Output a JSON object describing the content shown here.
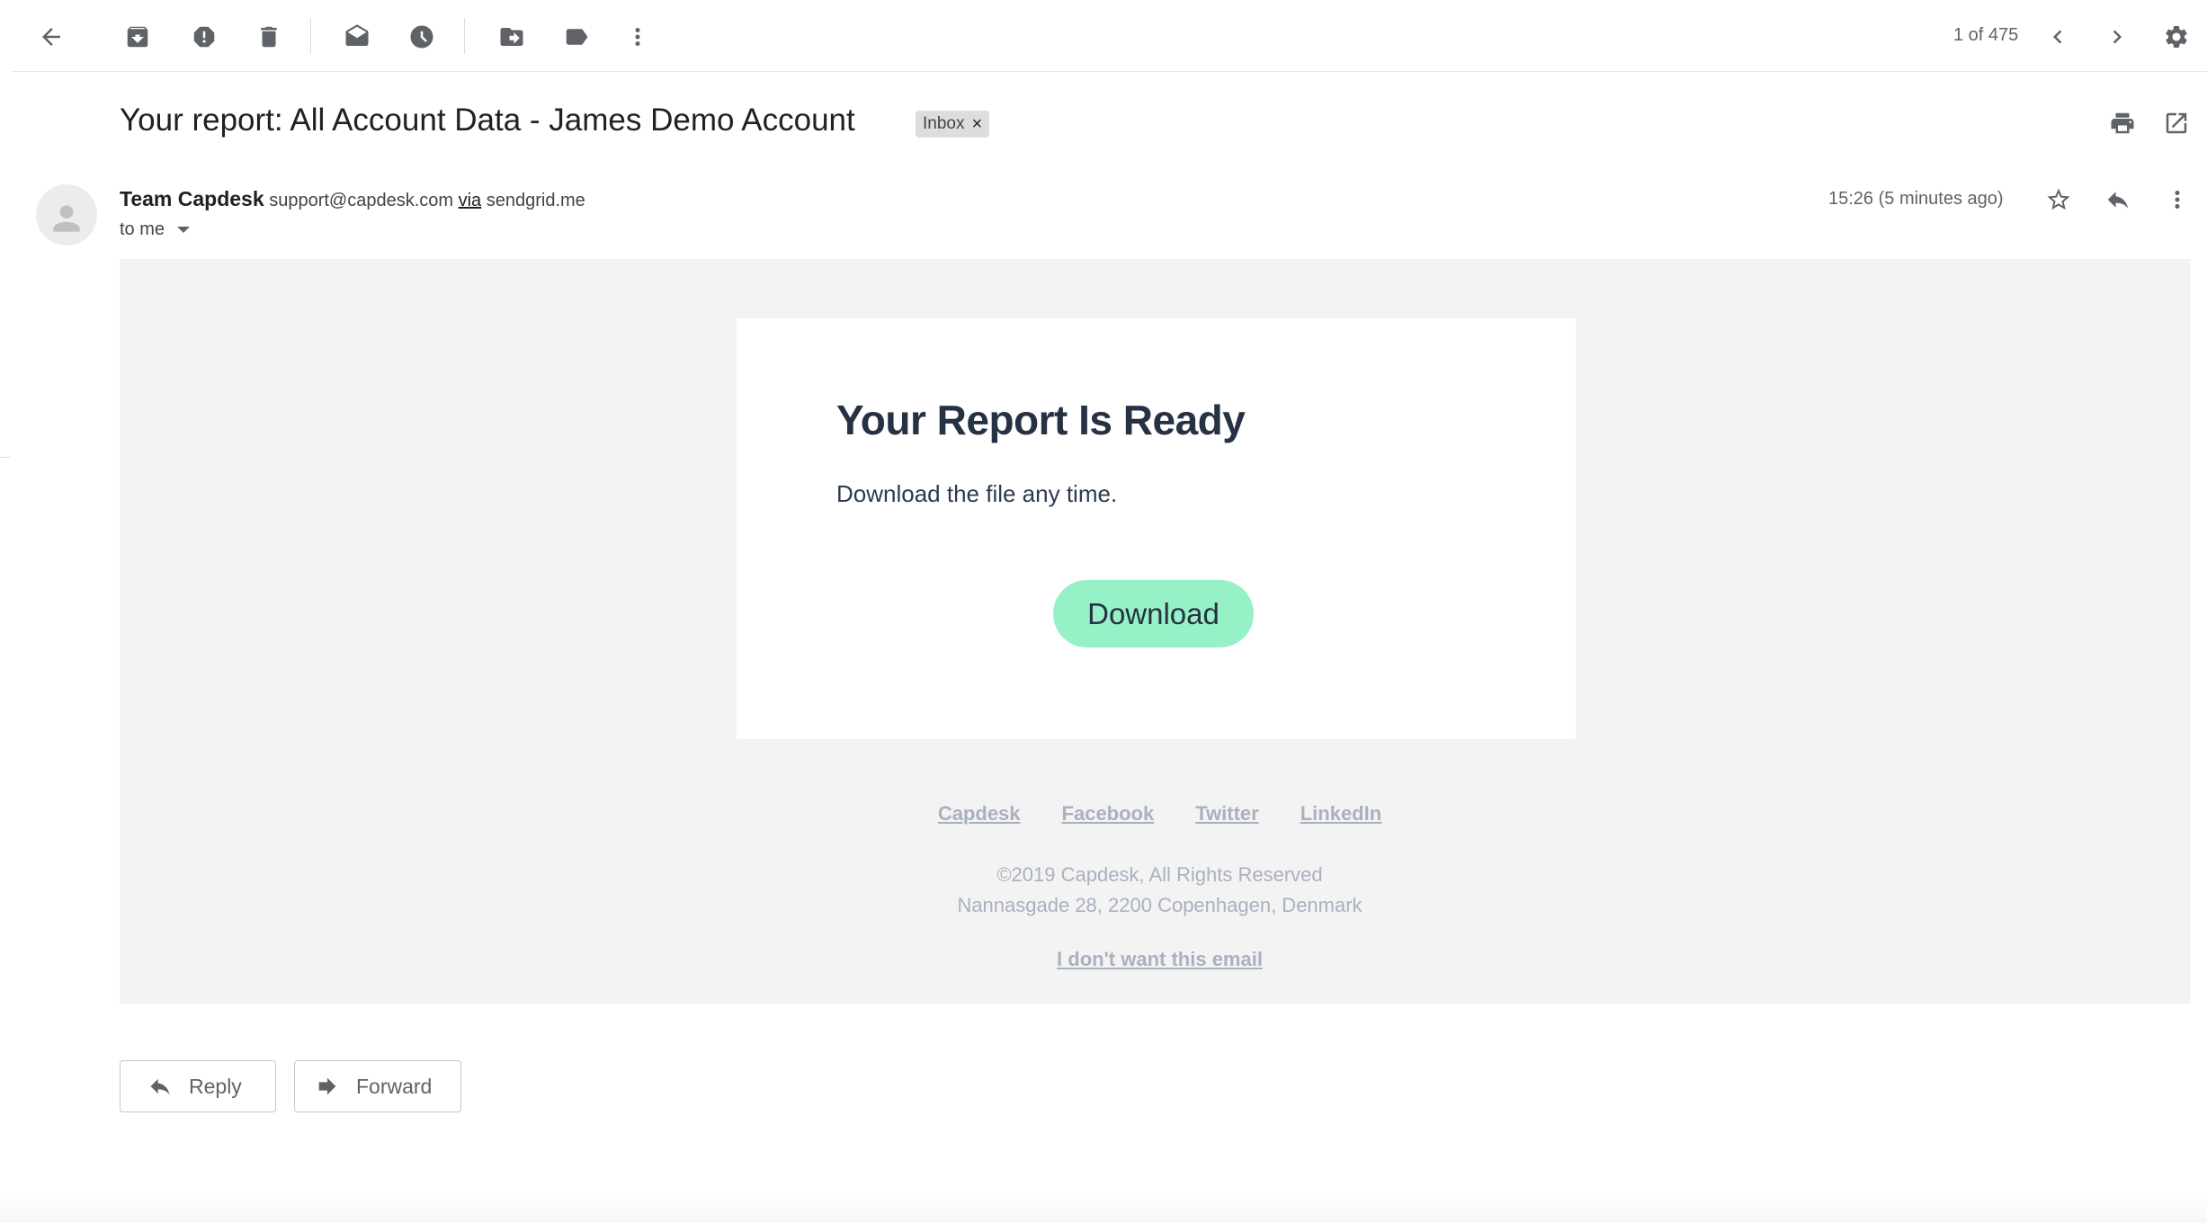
{
  "toolbar": {
    "pager_text": "1 of 475",
    "icons": [
      "back-arrow-icon",
      "archive-icon",
      "report-spam-icon",
      "delete-icon",
      "mark-unread-icon",
      "snooze-icon",
      "move-to-icon",
      "labels-icon",
      "more-vert-icon",
      "chevron-left-icon",
      "chevron-right-icon",
      "settings-gear-icon"
    ]
  },
  "message": {
    "subject": "Your report: All Account Data - James Demo Account",
    "label": "Inbox",
    "label_remove": "×",
    "sender_name": "Team Capdesk",
    "sender_email": "support@capdesk.com",
    "via_text": "via",
    "via_domain": "sendgrid.me",
    "to_text": "to me",
    "timestamp": "15:26 (5 minutes ago)"
  },
  "email": {
    "title": "Your Report Is Ready",
    "text": "Download the file any time.",
    "button_label": "Download",
    "button_color": "#97f1c6",
    "footer_links": [
      "Capdesk",
      "Facebook",
      "Twitter",
      "LinkedIn"
    ],
    "copyright_line1": "©2019 Capdesk, All Rights Reserved",
    "copyright_line2": "Nannasgade 28, 2200 Copenhagen, Denmark",
    "unsubscribe": "I don't want this email"
  },
  "actions": {
    "reply_label": "Reply",
    "forward_label": "Forward"
  }
}
